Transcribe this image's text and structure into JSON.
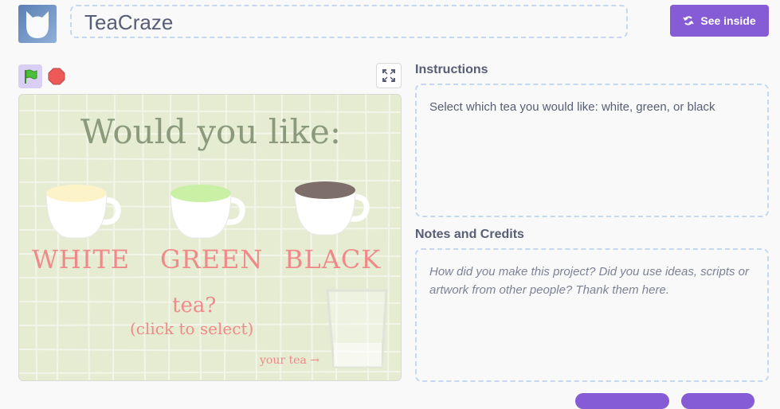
{
  "header": {
    "project_title": "TeaCraze",
    "see_inside_label": "See inside"
  },
  "stage": {
    "headline": "Would you like:",
    "options": [
      "WHITE",
      "GREEN",
      "BLACK"
    ],
    "prompt": "tea?",
    "hint": "(click to select)",
    "your_tea": "your tea →"
  },
  "instructions": {
    "label": "Instructions",
    "text": "Select which tea you would like: white, green, or black"
  },
  "notes": {
    "label": "Notes and Credits",
    "placeholder": "How did you make this project? Did you use ideas, scripts or artwork from other people? Thank them here."
  },
  "colors": {
    "accent": "#855cd6",
    "text": "#575e75",
    "stage_bg": "#e5ecd2",
    "tea_white": "#fdf3c8",
    "tea_green": "#c9f0a4",
    "tea_black": "#7d6e6a",
    "label_pink": "#f08a8a"
  },
  "icons": {
    "green_flag": "green-flag-icon",
    "stop": "stop-icon",
    "fullscreen": "fullscreen-icon",
    "see_inside": "remix-arrows-icon"
  }
}
